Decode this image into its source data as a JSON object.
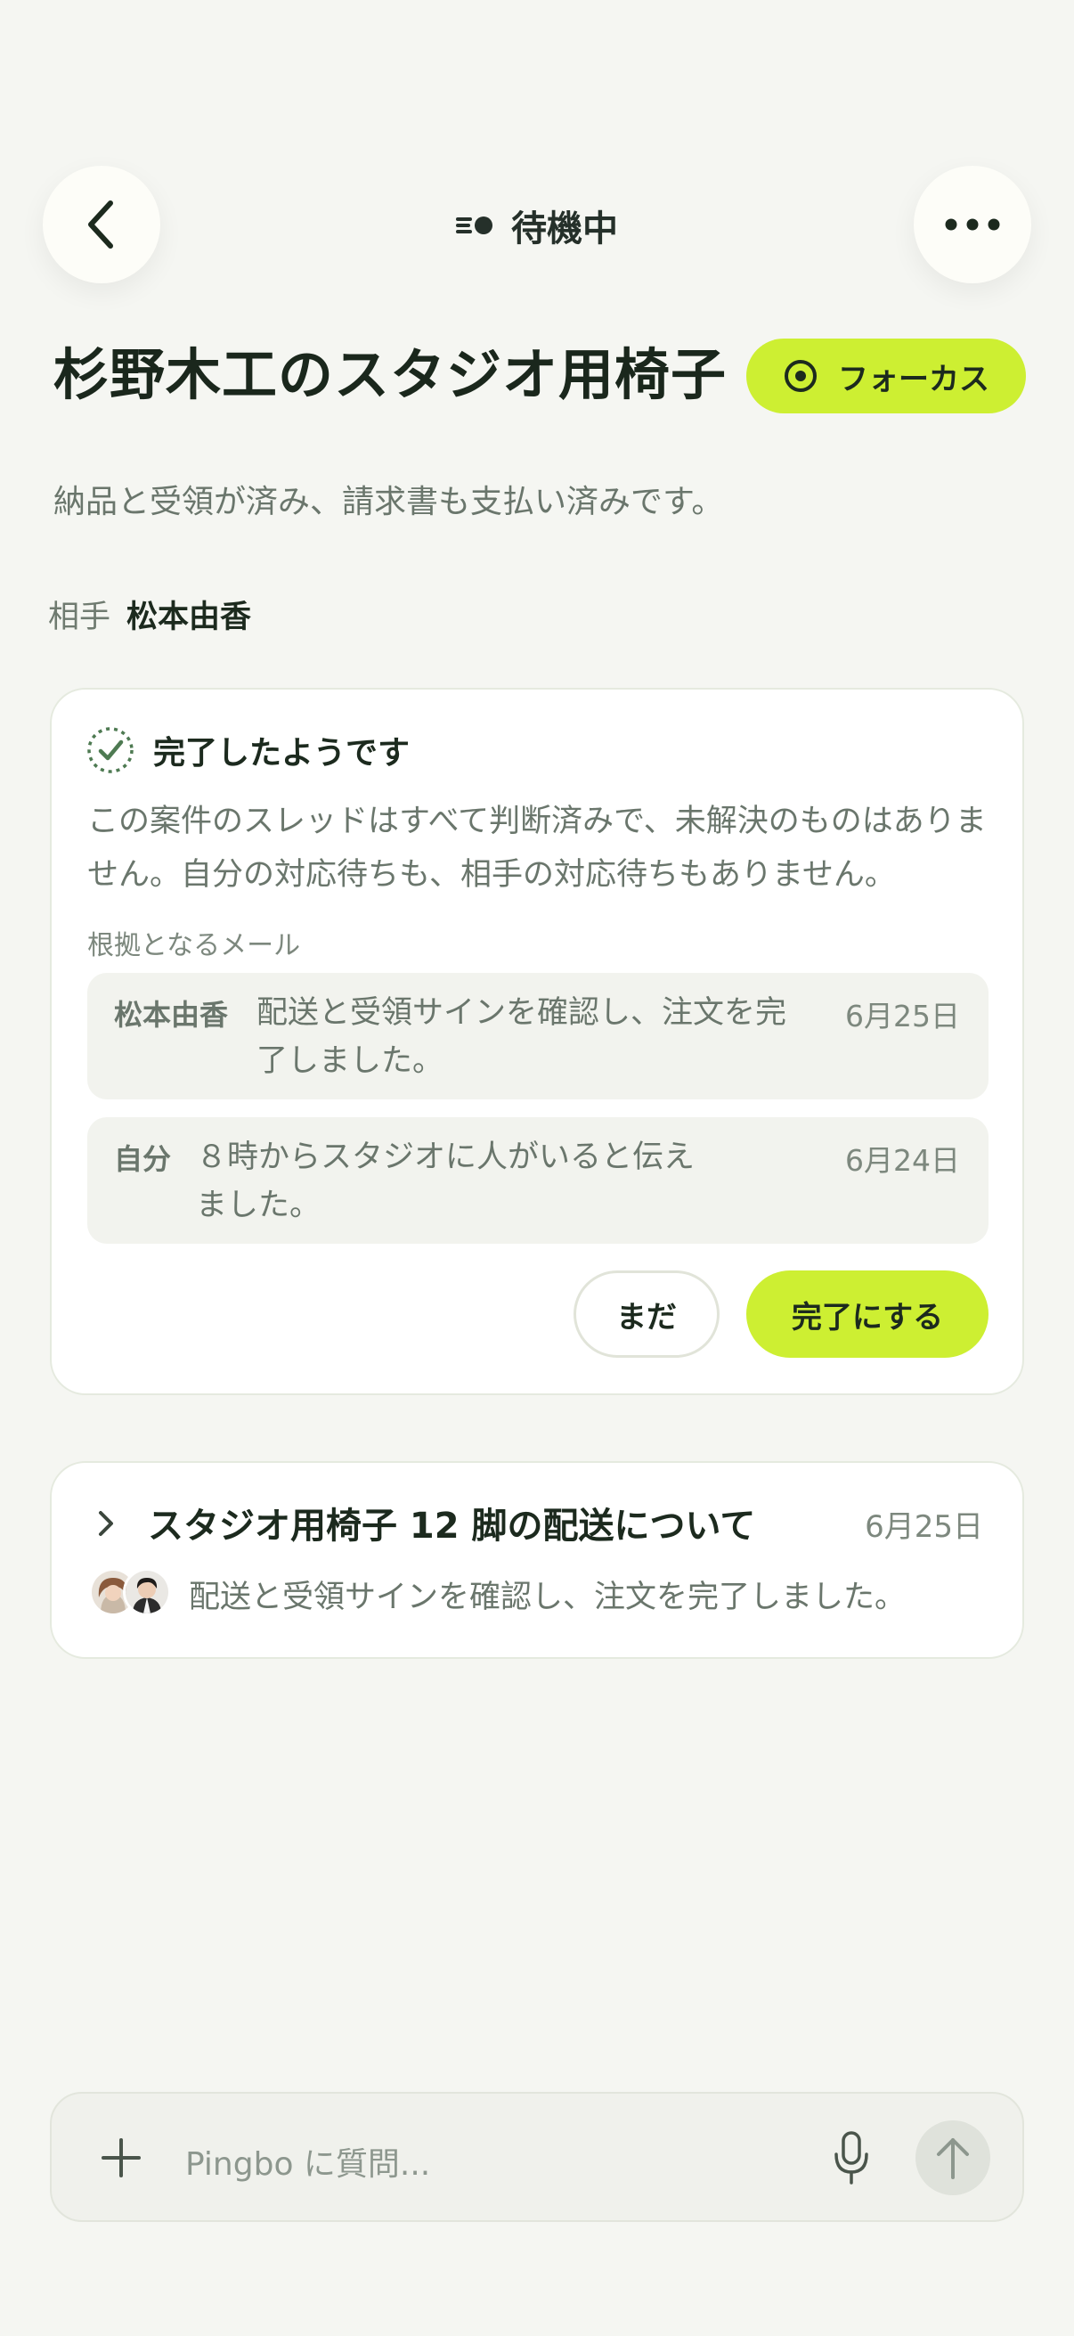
{
  "header": {
    "status_label": "待機中"
  },
  "deal": {
    "title": "杉野木工のスタジオ用椅子",
    "focus_label": "フォーカス",
    "subtitle": "納品と受領が済み、請求書も支払い済みです。",
    "partner_label": "相手",
    "partner_name": "松本由香"
  },
  "completion_card": {
    "heading": "完了したようです",
    "body": "この案件のスレッドはすべて判断済みで、未解決のものはありません。自分の対応待ちも、相手の対応待ちもありません。",
    "evidence_label": "根拠となるメール",
    "evidence": [
      {
        "sender": "松本由香",
        "message": "配送と受領サインを確認し、注文を完了しました。",
        "date": "6月25日"
      },
      {
        "sender": "自分",
        "message": "８時からスタジオに人がいると伝えました。",
        "date": "6月24日"
      }
    ],
    "not_yet_label": "まだ",
    "complete_label": "完了にする"
  },
  "thread": {
    "title": "スタジオ用椅子 12 脚の配送について",
    "date": "6月25日",
    "snippet": "配送と受領サインを確認し、注文を完了しました。"
  },
  "composer": {
    "placeholder": "Pingbo に質問..."
  },
  "colors": {
    "accent": "#cdef32",
    "background": "#f5f6f2",
    "card": "#ffffff"
  },
  "icons": [
    "chevron-left-icon",
    "more-horizontal-icon",
    "status-waiting-icon",
    "target-icon",
    "dashed-check-circle-icon",
    "chevron-right-icon",
    "plus-icon",
    "microphone-icon",
    "arrow-up-icon"
  ]
}
